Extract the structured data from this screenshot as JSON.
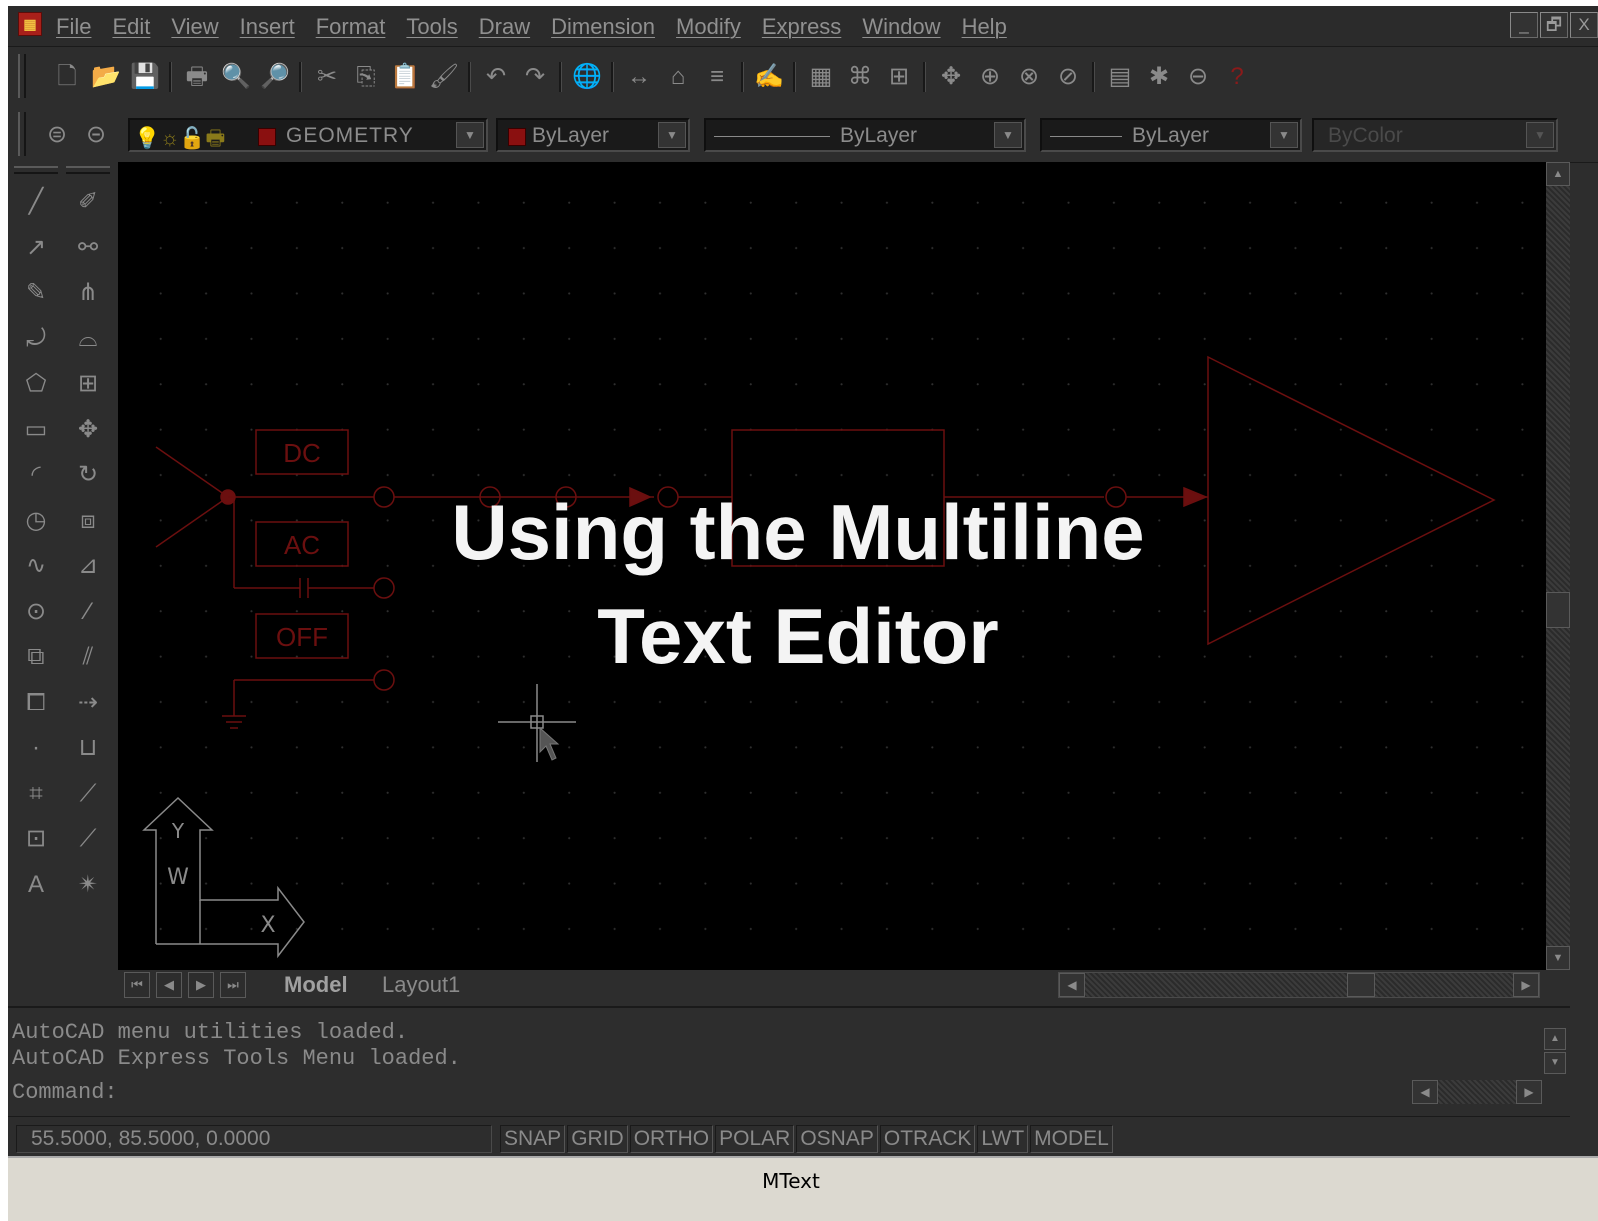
{
  "menu": {
    "items": [
      "File",
      "Edit",
      "View",
      "Insert",
      "Format",
      "Tools",
      "Draw",
      "Dimension",
      "Modify",
      "Express",
      "Window",
      "Help"
    ],
    "window_controls": [
      "_",
      "🗗",
      "X"
    ]
  },
  "toolbar_standard": {
    "icons": [
      "new-icon",
      "open-icon",
      "save-icon",
      "print-icon",
      "print-preview-icon",
      "find-icon",
      "cut-icon",
      "copy-icon",
      "paste-icon",
      "match-properties-icon",
      "undo-icon",
      "redo-icon",
      "web-icon",
      "distance-icon",
      "inquiry-icon",
      "layer-icon",
      "pen-icon",
      "properties-icon",
      "design-center-icon",
      "dview-icon",
      "pan-icon",
      "zoom-icon",
      "zoom-window-icon",
      "zoom-previous-icon",
      "toolpalette-icon",
      "render-icon",
      "db-icon",
      "help-icon"
    ],
    "glyphs": [
      "🗋",
      "📂",
      "💾",
      "🖶",
      "🔍",
      "🔎",
      "✂",
      "⎘",
      "📋",
      "🖌",
      "↶",
      "↷",
      "🌐",
      "↔",
      "⌂",
      "≡",
      "✍",
      "▦",
      "⌘",
      "⊞",
      "✥",
      "⊕",
      "⊗",
      "⊘",
      "▤",
      "✱",
      "⊖",
      "?"
    ]
  },
  "layer_bar": {
    "layer_name": "GEOMETRY",
    "color": "ByLayer",
    "linetype": "ByLayer",
    "lineweight": "ByLayer",
    "plotstyle": "ByColor"
  },
  "draw_toolbar": {
    "glyphs": [
      "╱",
      "↗",
      "✎",
      "⤾",
      "⬠",
      "▭",
      "◜",
      "◷",
      "∿",
      "⊙",
      "⧉",
      "⧠",
      "·",
      "⌗",
      "⊡",
      "A"
    ],
    "names": [
      "line-icon",
      "construction-line-icon",
      "polyline-icon",
      "polyline-arc-icon",
      "polygon-icon",
      "rectangle-icon",
      "arc-icon",
      "circle-icon",
      "spline-icon",
      "ellipse-icon",
      "insert-block-icon",
      "make-block-icon",
      "point-icon",
      "hatch-icon",
      "region-icon",
      "mtext-icon"
    ]
  },
  "modify_toolbar": {
    "glyphs": [
      "✐",
      "⚯",
      "⋔",
      "⌓",
      "⊞",
      "✥",
      "↻",
      "⧈",
      "⊿",
      "⁄",
      "⫽",
      "⇢",
      "⊔",
      "⟋",
      "⟋",
      "✴"
    ],
    "names": [
      "erase-icon",
      "copy-object-icon",
      "mirror-icon",
      "offset-icon",
      "array-icon",
      "move-icon",
      "rotate-icon",
      "scale-icon",
      "stretch-icon",
      "trim-icon",
      "extend-icon",
      "break-icon",
      "chamfer-icon",
      "fillet-icon",
      "fillet2-icon",
      "explode-icon"
    ]
  },
  "schematic": {
    "labels": [
      "DC",
      "AC",
      "OFF"
    ]
  },
  "overlay": {
    "line1": "Using the Multiline",
    "line2": "Text Editor"
  },
  "ucs": {
    "y_label": "Y",
    "w_label": "W",
    "x_label": "X"
  },
  "tabs": {
    "items": [
      "Model",
      "Layout1"
    ],
    "active": "Model"
  },
  "command": {
    "history": [
      "AutoCAD menu utilities loaded.",
      "AutoCAD Express Tools Menu loaded."
    ],
    "prompt": "Command:"
  },
  "status": {
    "coordinates": "55.5000, 85.5000, 0.0000",
    "toggles": [
      "SNAP",
      "GRID",
      "ORTHO",
      "POLAR",
      "OSNAP",
      "OTRACK",
      "LWT",
      "MODEL"
    ]
  },
  "caption": "MText",
  "colors": {
    "schematic": "#6b0f0f",
    "overlay_text": "#f4f4f4",
    "background": "#000000"
  }
}
